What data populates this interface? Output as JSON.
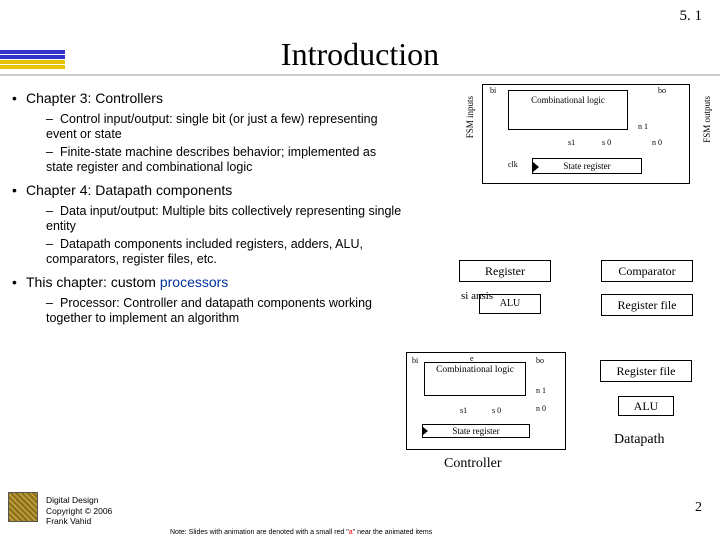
{
  "slide_number": "5. 1",
  "title": "Introduction",
  "bullets": {
    "ch3": {
      "label": "Chapter 3: Controllers",
      "sub1": "Control input/output: single bit (or just a few) representing event or state",
      "sub2": "Finite-state machine describes behavior; implemented as state register and combinational logic"
    },
    "ch4": {
      "label": "Chapter 4: Datapath components",
      "sub1": "Data input/output: Multiple bits collectively representing single entity",
      "sub2": "Datapath components included registers, adders, ALU, comparators, register files, etc."
    },
    "ch5": {
      "label_pre": "This chapter: custom ",
      "label_proc": "processors",
      "sub1": "Processor: Controller and datapath components working together to implement an algorithm"
    }
  },
  "fsm": {
    "inputs_label": "FSM inputs",
    "outputs_label": "FSM outputs",
    "comb": "Combinational logic",
    "sreg": "State register",
    "bi": "bi",
    "bo": "bo",
    "n1": "n 1",
    "n0": "n 0",
    "s1": "s1",
    "s0": "s 0",
    "clk": "clk"
  },
  "mid": {
    "register": "Register",
    "comparator": "Comparator",
    "siansis": "si ansis",
    "alu": "ALU",
    "regfile": "Register file"
  },
  "bot": {
    "comb": "Combinational logic",
    "sreg": "State register",
    "bi": "bi",
    "bo": "bo",
    "n1": "n 1",
    "n0": "n 0",
    "s1": "s1",
    "s0": "s 0",
    "e": "e",
    "controller": "Controller",
    "regfile": "Register file",
    "alu": "ALU",
    "datapath": "Datapath"
  },
  "footer": {
    "l1": "Digital Design",
    "l2": "Copyright © 2006",
    "l3": "Frank Vahid"
  },
  "note_pre": "Note: Slides with animation are denoted with a small red \"",
  "note_a": "a",
  "note_post": "\" near the animated items",
  "page": "2"
}
